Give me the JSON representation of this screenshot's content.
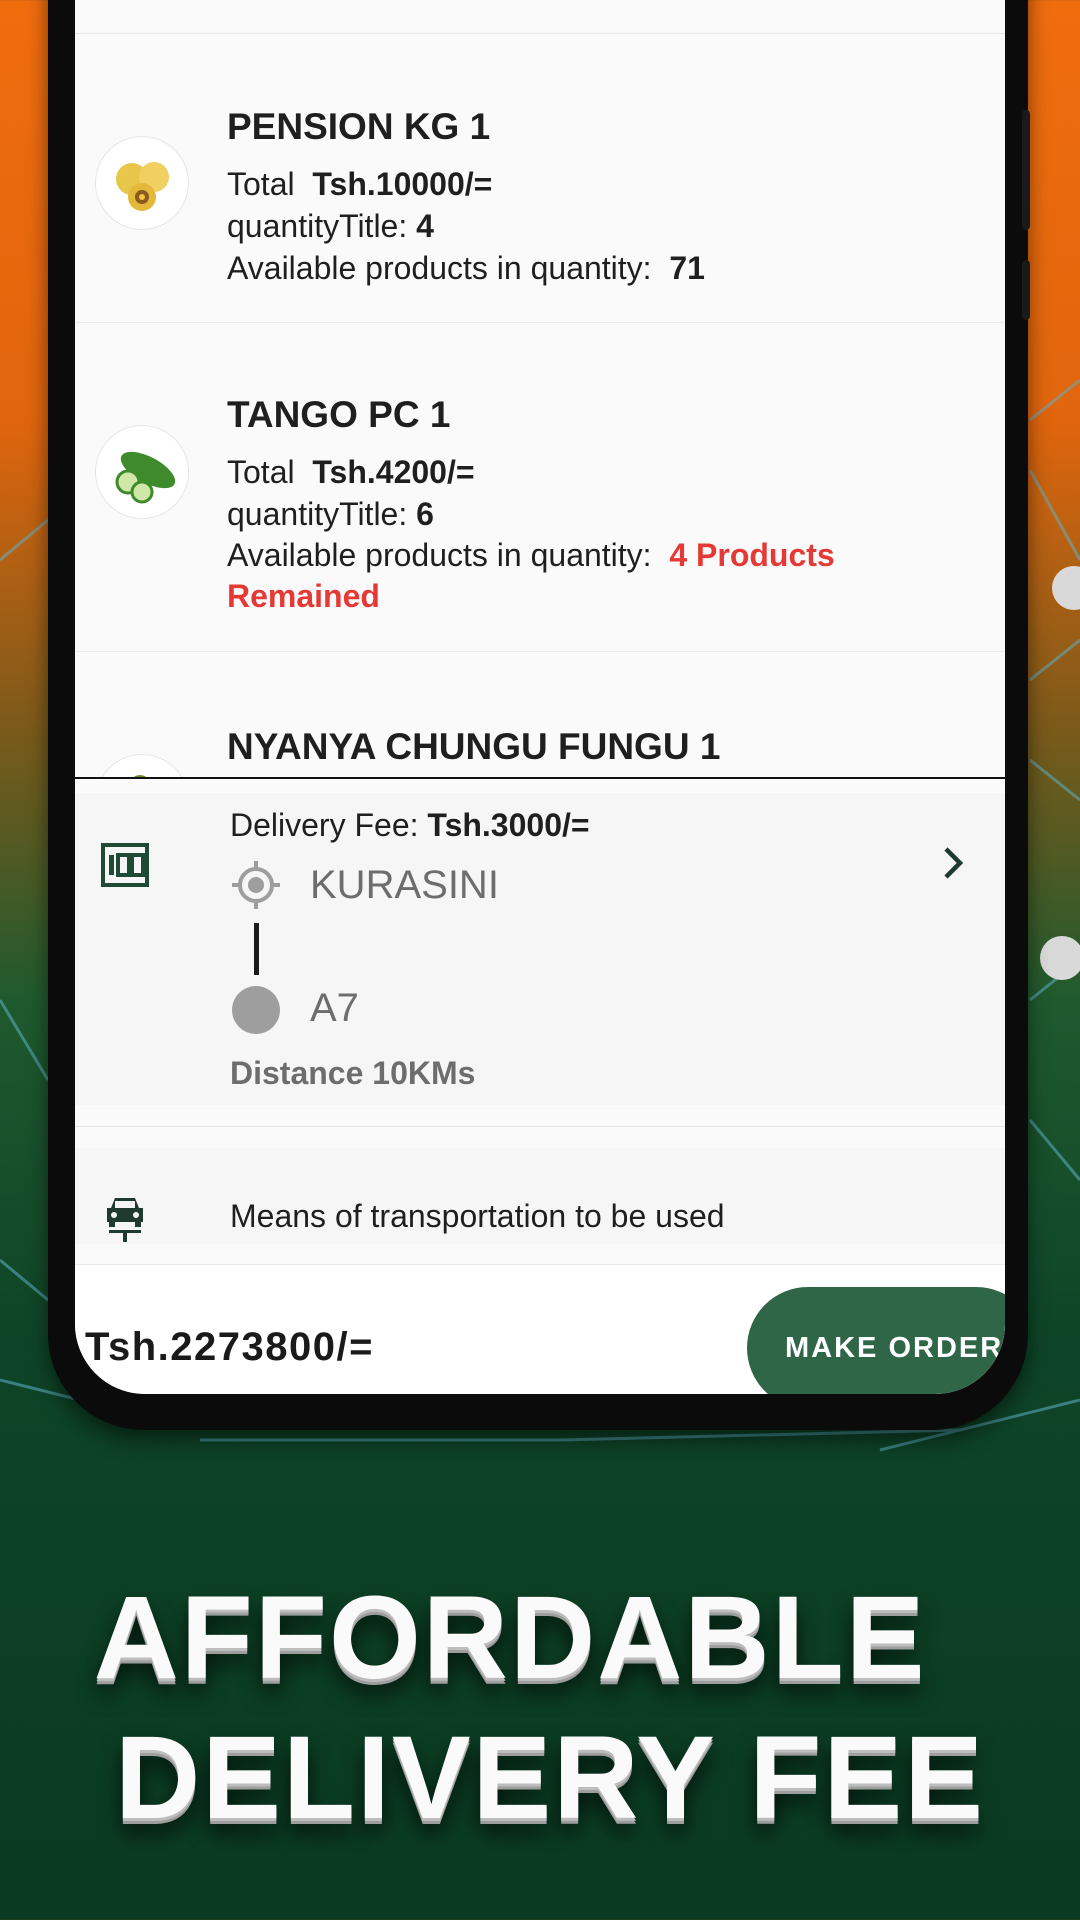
{
  "products": [
    {
      "name": "PENSION KG 1",
      "total_label": "Total",
      "total_value": "Tsh.10000/=",
      "quantity_label": "quantityTitle:",
      "quantity_value": "4",
      "available_label": "Available products in quantity:",
      "available_value": "71",
      "image_icon": "passion-fruit-icon"
    },
    {
      "name": "TANGO PC 1",
      "total_label": "Total",
      "total_value": "Tsh.4200/=",
      "quantity_label": "quantityTitle:",
      "quantity_value": "6",
      "available_label": "Available products in quantity:",
      "available_value_line1": "4 Products",
      "available_value_line2": "Remained",
      "image_icon": "cucumber-icon"
    },
    {
      "name": "NYANYA CHUNGU FUNGU 1",
      "image_icon": "eggplant-icon"
    }
  ],
  "delivery": {
    "fee_label": "Delivery Fee:",
    "fee_value": "Tsh.3000/=",
    "origin": "KURASINI",
    "destination": "A7",
    "distance": "Distance 10KMs",
    "icon": "speed-limit-icon",
    "chevron_icon": "chevron-right-icon"
  },
  "transport": {
    "label": "Means of transportation to be used",
    "icon": "car-icon"
  },
  "footer": {
    "total": "Tsh.2273800/=",
    "order_button": "MAKE ORDER"
  },
  "promo": {
    "line1": "AFFORDABLE",
    "line2": "DELIVERY FEE"
  },
  "colors": {
    "accent": "#2f6647",
    "warning": "#e53935",
    "bg_top": "#f06d0e",
    "bg_bottom": "#0a3a22"
  }
}
